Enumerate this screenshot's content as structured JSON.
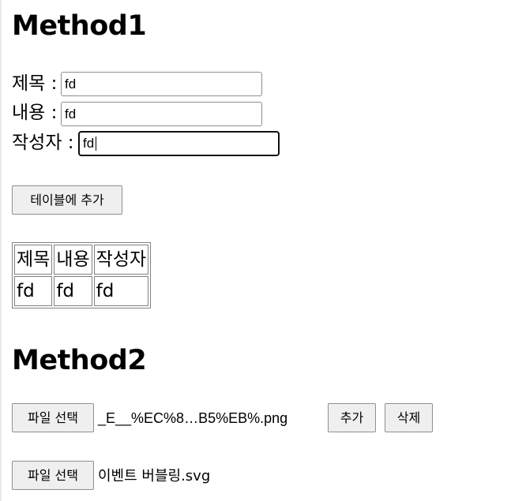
{
  "method1": {
    "heading": "Method1",
    "fields": {
      "title": {
        "label": "제목 :",
        "value": "fd"
      },
      "content": {
        "label": "내용 :",
        "value": "fd"
      },
      "author": {
        "label": "작성자 :",
        "value": "fd"
      }
    },
    "add_button": "테이블에 추가",
    "table": {
      "headers": [
        "제목",
        "내용",
        "작성자"
      ],
      "rows": [
        [
          "fd",
          "fd",
          "fd"
        ]
      ]
    }
  },
  "method2": {
    "heading": "Method2",
    "file_row1": {
      "choose_button": "파일 선택",
      "file_name": "_E__%EC%8…B5%EB%.png",
      "add_button": "추가",
      "delete_button": "삭제"
    },
    "file_row2": {
      "choose_button": "파일 선택",
      "file_name": "이벤트 버블링.svg"
    }
  }
}
